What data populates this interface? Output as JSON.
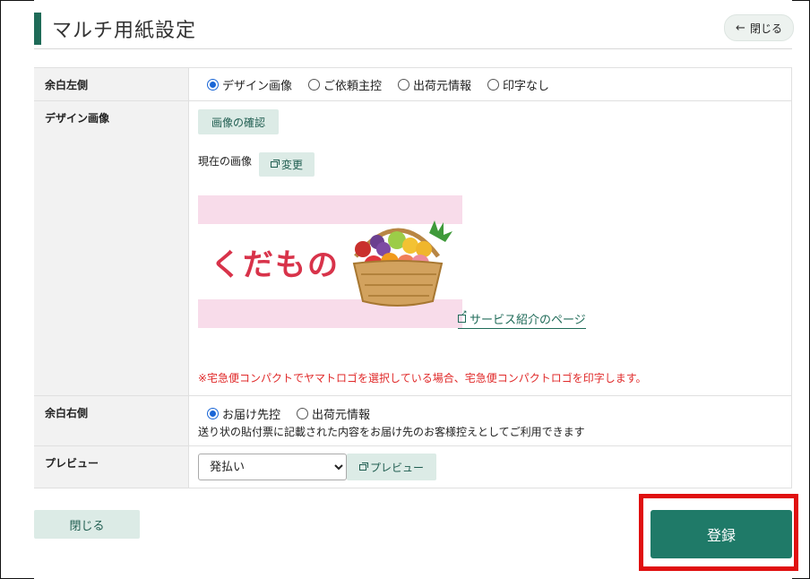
{
  "header": {
    "title": "マルチ用紙設定",
    "close_label": "閉じる"
  },
  "left_margin": {
    "label": "余白左側",
    "options": [
      {
        "label": "デザイン画像",
        "selected": true
      },
      {
        "label": "ご依頼主控",
        "selected": false
      },
      {
        "label": "出荷元情報",
        "selected": false
      },
      {
        "label": "印字なし",
        "selected": false
      }
    ]
  },
  "design_image": {
    "label": "デザイン画像",
    "check_button": "画像の確認",
    "current_label": "現在の画像",
    "change_button": "変更",
    "image_text": "くだもの",
    "service_link": "サービス紹介のページ",
    "warning": "※宅急便コンパクトでヤマトロゴを選択している場合、宅急便コンパクトロゴを印字します。"
  },
  "right_margin": {
    "label": "余白右側",
    "options": [
      {
        "label": "お届け先控",
        "selected": true
      },
      {
        "label": "出荷元情報",
        "selected": false
      }
    ],
    "note": "送り状の貼付票に記載された内容をお届け先のお客様控えとしてご利用できます"
  },
  "preview": {
    "label": "プレビュー",
    "select_value": "発払い",
    "button": "プレビュー"
  },
  "footer": {
    "close_label": "閉じる",
    "register_label": "登録"
  },
  "colors": {
    "accent": "#1f7a68",
    "highlight": "#e01010",
    "warning": "#e02a2a"
  }
}
